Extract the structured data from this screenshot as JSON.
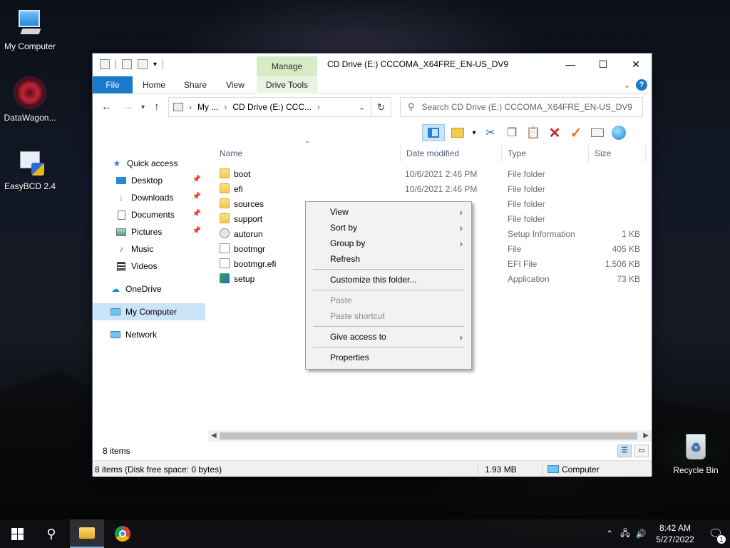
{
  "desktop": {
    "icons": [
      {
        "label": "My Computer"
      },
      {
        "label": "DataWagon..."
      },
      {
        "label": "EasyBCD 2.4"
      },
      {
        "label": "Recycle Bin"
      }
    ]
  },
  "window": {
    "title": "CD Drive (E:) CCCOMA_X64FRE_EN-US_DV9",
    "manage_tab": "Manage",
    "controls": {
      "minimize": "—",
      "maximize": "☐",
      "close": "✕"
    }
  },
  "ribbon": {
    "tabs": [
      "File",
      "Home",
      "Share",
      "View",
      "Drive Tools"
    ],
    "help": "?"
  },
  "address": {
    "crumbs": [
      "My ...",
      "CD Drive (E:) CCC..."
    ],
    "search_placeholder": "Search CD Drive (E:) CCCOMA_X64FRE_EN-US_DV9"
  },
  "nav": {
    "items": [
      {
        "label": "Quick access",
        "icon": "star-icon"
      },
      {
        "label": "Desktop",
        "icon": "desktop-icon",
        "pinned": true
      },
      {
        "label": "Downloads",
        "icon": "download-icon",
        "pinned": true
      },
      {
        "label": "Documents",
        "icon": "documents-icon",
        "pinned": true
      },
      {
        "label": "Pictures",
        "icon": "pictures-icon",
        "pinned": true
      },
      {
        "label": "Music",
        "icon": "music-icon"
      },
      {
        "label": "Videos",
        "icon": "videos-icon"
      },
      {
        "label": "OneDrive",
        "icon": "cloud-icon"
      },
      {
        "label": "My Computer",
        "icon": "computer-icon",
        "selected": true
      },
      {
        "label": "Network",
        "icon": "network-icon"
      }
    ]
  },
  "files": {
    "columns": [
      "Name",
      "Date modified",
      "Type",
      "Size"
    ],
    "rows": [
      {
        "name": "boot",
        "date": "10/6/2021 2:46 PM",
        "type": "File folder",
        "size": ""
      },
      {
        "name": "efi",
        "date": "10/6/2021 2:46 PM",
        "type": "File folder",
        "size": ""
      },
      {
        "name": "sources",
        "date": "",
        "type": "File folder",
        "size": ""
      },
      {
        "name": "support",
        "date": "",
        "type": "File folder",
        "size": ""
      },
      {
        "name": "autorun",
        "date": "",
        "type": "Setup Information",
        "size": "1 KB"
      },
      {
        "name": "bootmgr",
        "date": "",
        "type": "File",
        "size": "405 KB"
      },
      {
        "name": "bootmgr.efi",
        "date": "",
        "type": "EFI File",
        "size": "1,506 KB"
      },
      {
        "name": "setup",
        "date": "",
        "type": "Application",
        "size": "73 KB"
      }
    ]
  },
  "context_menu": {
    "items": [
      "View",
      "Sort by",
      "Group by",
      "Refresh",
      "Customize this folder...",
      "Paste",
      "Paste shortcut",
      "Give access to",
      "Properties"
    ]
  },
  "status": {
    "item_count": "8 items",
    "detail": "8 items (Disk free space: 0 bytes)",
    "size": "1.93 MB",
    "location": "Computer"
  },
  "taskbar": {
    "time": "8:42 AM",
    "date": "5/27/2022",
    "notifications": "1"
  }
}
